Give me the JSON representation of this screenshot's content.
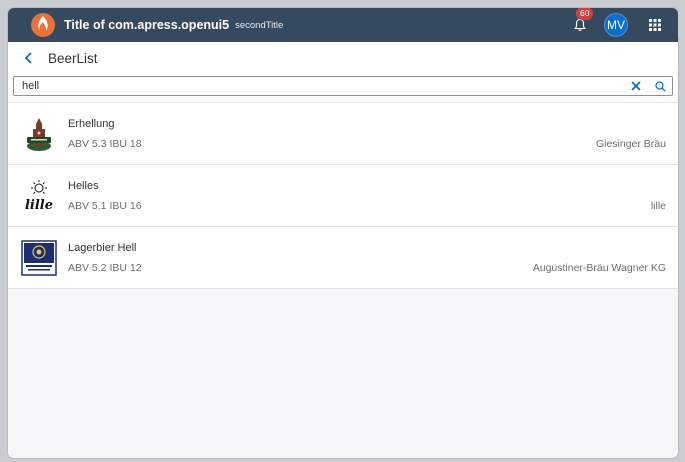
{
  "shell": {
    "title": "Title of com.apress.openui5",
    "subtitle": "secondTitle",
    "notification_count": "60",
    "avatar_initials": "MV"
  },
  "page": {
    "title": "BeerList"
  },
  "search": {
    "value": "hell",
    "placeholder": ""
  },
  "beers": [
    {
      "name": "Erhellung",
      "abv_ibu": "ABV 5.3 IBU 18",
      "brewery": "Giesinger Bräu",
      "logo": "giesinger-logo"
    },
    {
      "name": "Helles",
      "abv_ibu": "ABV 5.1 IBU 16",
      "brewery": "lille",
      "logo": "lille-logo",
      "logo_text": "lille"
    },
    {
      "name": "Lagerbier Hell",
      "abv_ibu": "ABV 5.2 IBU 12",
      "brewery": "Augustiner-Bräu Wagner KG",
      "logo": "augustiner-logo"
    }
  ],
  "colors": {
    "shellbar": "#354a5f",
    "accent": "#0a6ed1",
    "badge": "#d04343"
  }
}
